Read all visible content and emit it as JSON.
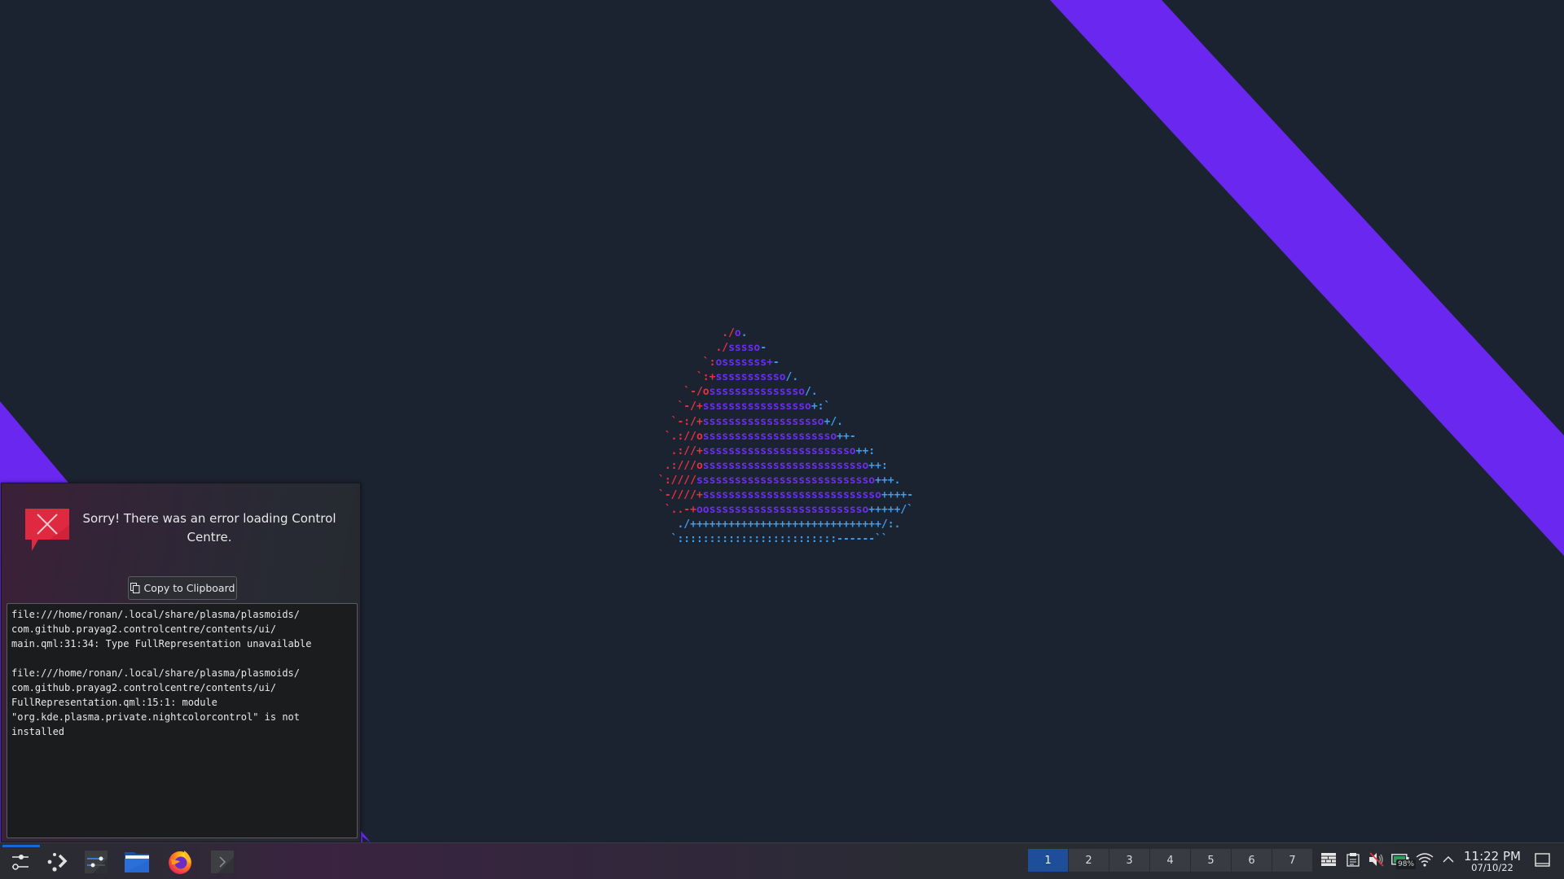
{
  "desktop": {
    "colors": {
      "background": "#1b2230",
      "stripe": "#6927ef",
      "logo_red": "#e8323f",
      "logo_purple": "#6b2ff0",
      "logo_blue": "#3d9ff0"
    },
    "ascii_logo": [
      [
        [
          "r",
          "          ./"
        ],
        [
          "p",
          "o"
        ],
        [
          "b",
          "."
        ]
      ],
      [
        [
          "r",
          "         ./"
        ],
        [
          "p",
          "sssso"
        ],
        [
          "b",
          "-"
        ]
      ],
      [
        [
          "r",
          "       `:"
        ],
        [
          "p",
          "osssssss+"
        ],
        [
          "b",
          "-"
        ]
      ],
      [
        [
          "r",
          "      `:+"
        ],
        [
          "p",
          "sssssssssso"
        ],
        [
          "b",
          "/."
        ]
      ],
      [
        [
          "r",
          "    `-/o"
        ],
        [
          "p",
          "sssssssssssssso"
        ],
        [
          "b",
          "/."
        ]
      ],
      [
        [
          "r",
          "   `-/+"
        ],
        [
          "p",
          "sssssssssssssssso"
        ],
        [
          "b",
          "+:`"
        ]
      ],
      [
        [
          "r",
          "  `-:/+"
        ],
        [
          "p",
          "sssssssssssssssssso"
        ],
        [
          "b",
          "+/."
        ]
      ],
      [
        [
          "r",
          " `.://o"
        ],
        [
          "p",
          "sssssssssssssssssssso"
        ],
        [
          "b",
          "++-"
        ]
      ],
      [
        [
          "r",
          "  .://+"
        ],
        [
          "p",
          "ssssssssssssssssssssssso"
        ],
        [
          "b",
          "++:"
        ]
      ],
      [
        [
          "r",
          " .:///o"
        ],
        [
          "p",
          "ssssssssssssssssssssssssso"
        ],
        [
          "b",
          "++:"
        ]
      ],
      [
        [
          "r",
          "`:////"
        ],
        [
          "p",
          "ssssssssssssssssssssssssssso"
        ],
        [
          "b",
          "+++."
        ]
      ],
      [
        [
          "r",
          "`-////+"
        ],
        [
          "p",
          "ssssssssssssssssssssssssssso"
        ],
        [
          "b",
          "++++-"
        ]
      ],
      [
        [
          "r",
          " `..-+"
        ],
        [
          "p",
          "oosssssssssssssssssssssssso"
        ],
        [
          "b",
          "+++++/`"
        ]
      ],
      [
        [
          "b",
          "   ./++++++++++++++++++++++++++++++/:."
        ]
      ],
      [
        [
          "b",
          "  `:::::::::::::::::::::::::------``"
        ]
      ]
    ]
  },
  "error_popup": {
    "message": "Sorry! There was an error loading Control Centre.",
    "copy_button_label": "Copy to Clipboard",
    "log_text": "file:///home/ronan/.local/share/plasma/plasmoids/\ncom.github.prayag2.controlcentre/contents/ui/\nmain.qml:31:34: Type FullRepresentation unavailable\n\nfile:///home/ronan/.local/share/plasma/plasmoids/\ncom.github.prayag2.controlcentre/contents/ui/\nFullRepresentation.qml:15:1: module\n\"org.kde.plasma.private.nightcolorcontrol\" is not\ninstalled"
  },
  "taskbar": {
    "launchers": [
      {
        "name": "control-centre",
        "icon": "sliders-icon",
        "active": true
      },
      {
        "name": "application-launcher",
        "icon": "launcher-dots-arrow-icon"
      },
      {
        "name": "system-settings",
        "icon": "settings-sliders-icon"
      },
      {
        "name": "file-manager",
        "icon": "folder-icon"
      },
      {
        "name": "firefox",
        "icon": "firefox-icon"
      },
      {
        "name": "terminal",
        "icon": "terminal-icon"
      }
    ],
    "pager": {
      "desktops": [
        "1",
        "2",
        "3",
        "4",
        "5",
        "6",
        "7"
      ],
      "active_index": 0
    },
    "tray": {
      "icons": [
        "keyboard-layout-icon",
        "clipboard-icon",
        "volume-muted-icon",
        "battery-icon",
        "wifi-icon",
        "expand-tray-chevron-up-icon"
      ],
      "battery_percent": "98%"
    },
    "clock": {
      "time": "11:22 PM",
      "date": "07/10/22"
    },
    "show_desktop": "show-desktop-icon"
  }
}
